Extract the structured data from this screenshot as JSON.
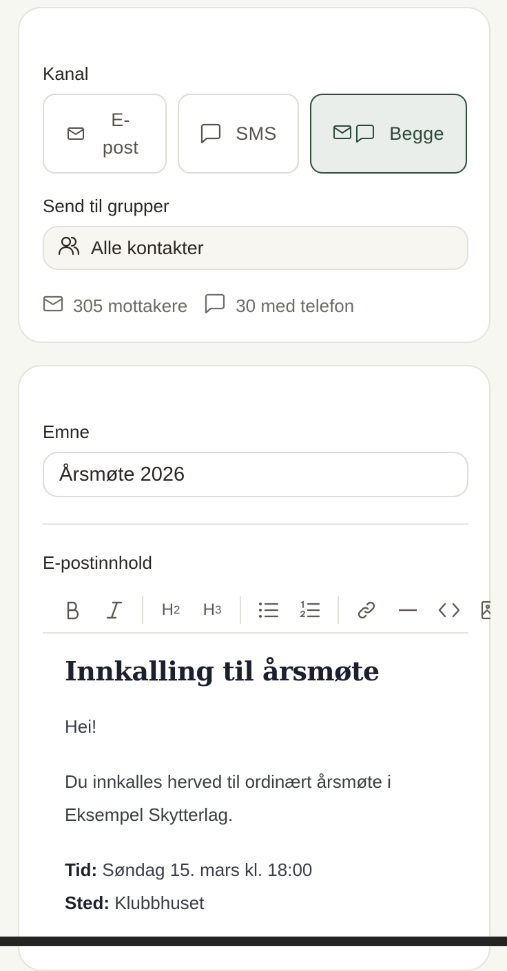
{
  "channel": {
    "label": "Kanal",
    "options": [
      {
        "label_line1": "E-",
        "label_line2": "post",
        "icon": "mail-icon",
        "selected": false
      },
      {
        "label": "SMS",
        "icon": "chat-bubble-icon",
        "selected": false
      },
      {
        "label": "Begge",
        "icon": "mail-and-chat-icon",
        "selected": true
      }
    ]
  },
  "groups": {
    "label": "Send til grupper",
    "value": "Alle kontakter",
    "icon": "users-icon"
  },
  "stats": {
    "recipients": "305 mottakere",
    "with_phone": "30 med telefon"
  },
  "subject": {
    "label": "Emne",
    "value": "Årsmøte 2026"
  },
  "content": {
    "label": "E-postinnhold",
    "toolbar": [
      "bold-icon",
      "italic-icon",
      "heading-2",
      "heading-3",
      "bullet-list-icon",
      "numbered-list-icon",
      "link-icon",
      "horizontal-rule-icon",
      "code-icon",
      "image-icon"
    ],
    "heading": "Innkalling til årsmøte",
    "greeting": "Hei!",
    "body": "Du innkalles herved til ordinært årsmøte i Eksempel Skytterlag.",
    "time_label": "Tid:",
    "time_value": "Søndag 15. mars kl. 18:00",
    "place_label": "Sted:",
    "place_value": "Klubbhuset"
  },
  "colors": {
    "accent": "#2e4d3a",
    "accent_bg": "#e9eeeb",
    "page_bg": "#f7f7f2"
  }
}
